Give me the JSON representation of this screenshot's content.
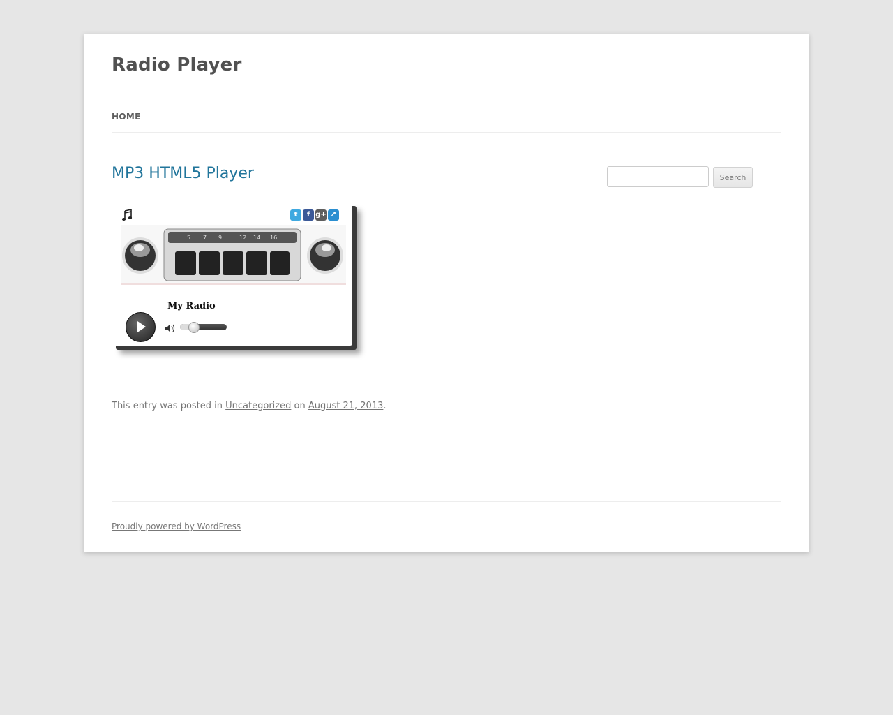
{
  "site": {
    "title": "Radio Player"
  },
  "nav": {
    "items": [
      {
        "label": "HOME"
      }
    ]
  },
  "post": {
    "title": "MP3 HTML5 Player",
    "meta": {
      "prefix": "This entry was posted in",
      "category": "Uncategorized",
      "middle": "on",
      "date": "August 21, 2013",
      "suffix": "."
    }
  },
  "player": {
    "station": "My Radio",
    "volume": 0.28,
    "share": [
      "twitter-icon",
      "facebook-icon",
      "google-plus-icon",
      "external-link-icon"
    ],
    "icons": {
      "play": "play-icon",
      "music": "music-note-icon",
      "volume": "speaker-icon"
    }
  },
  "search": {
    "button_label": "Search",
    "value": ""
  },
  "footer": {
    "link_text": "Proudly powered by WordPress"
  },
  "colors": {
    "background": "#e6e6e6",
    "link_blue": "#21759b",
    "text": "#444444"
  }
}
